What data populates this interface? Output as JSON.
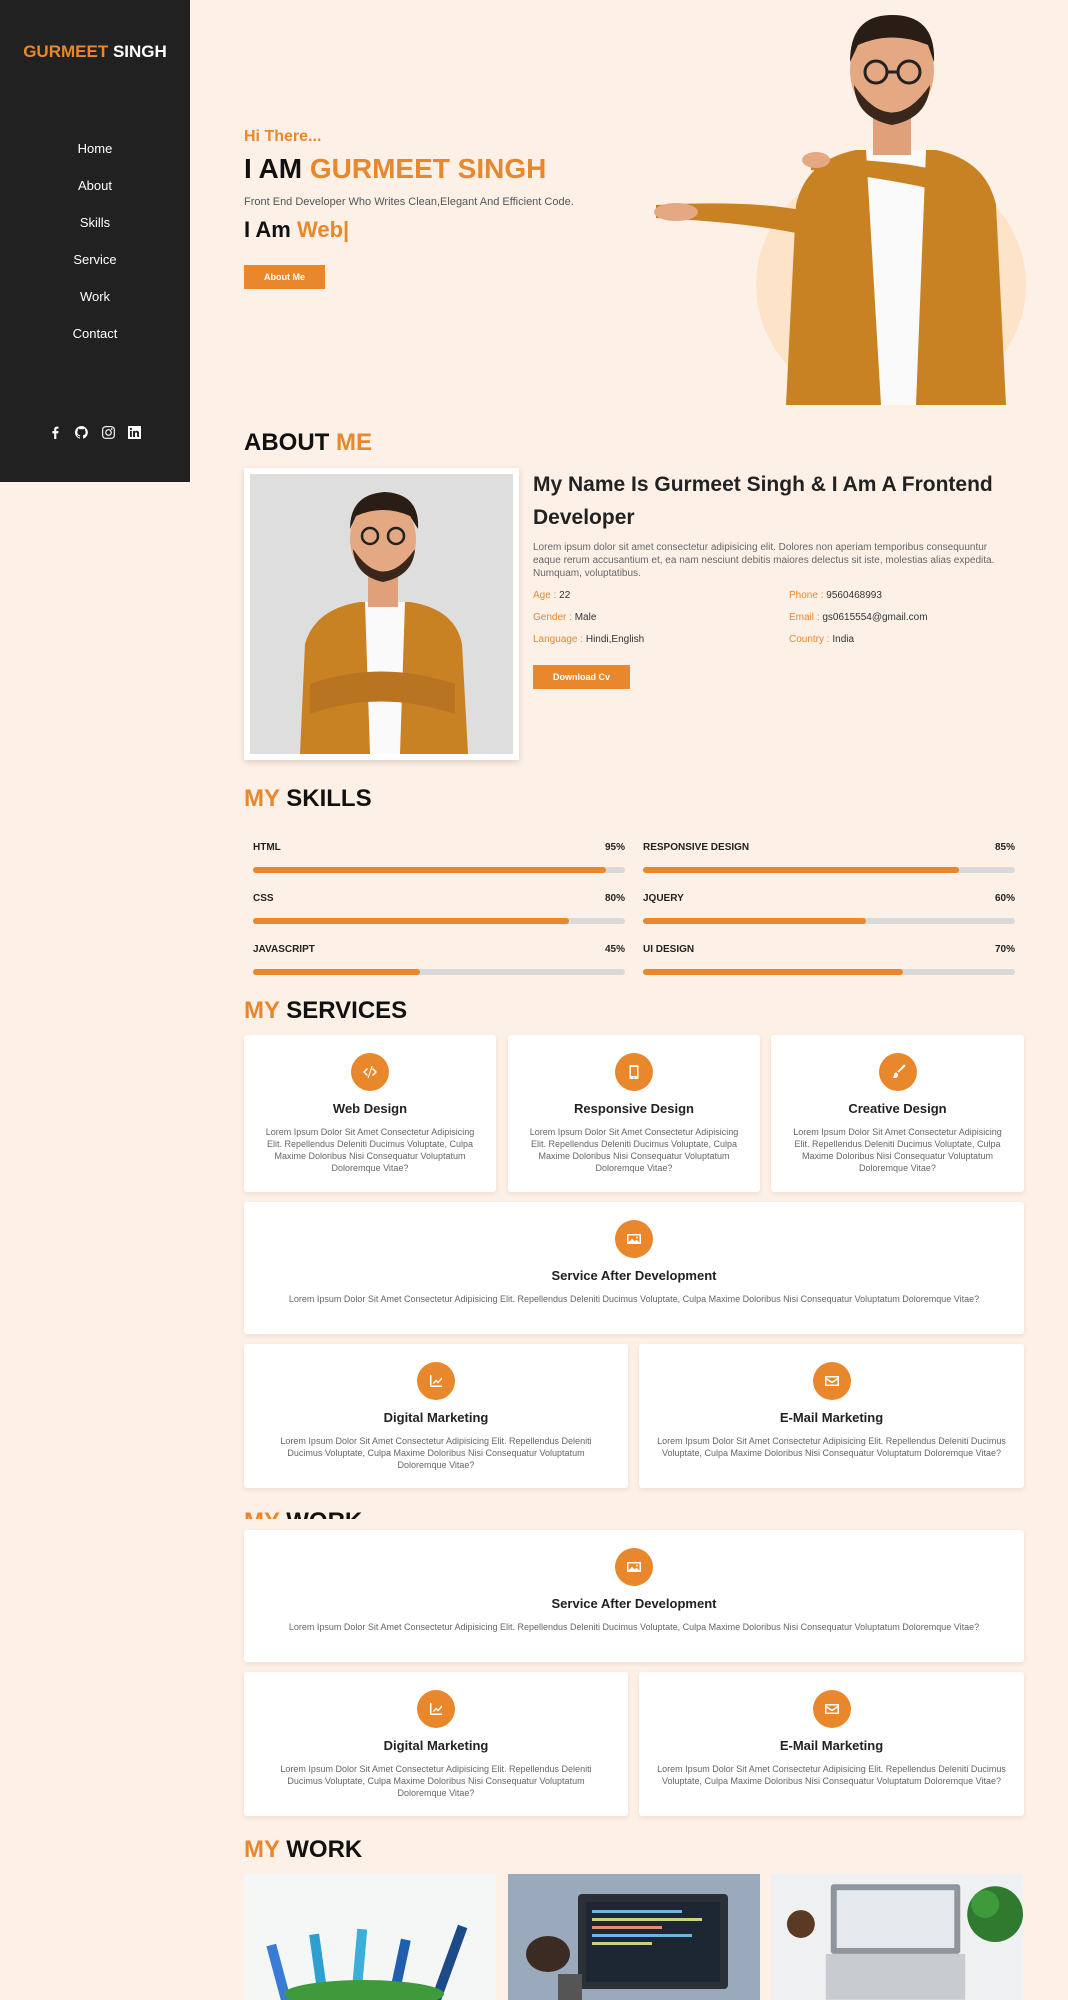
{
  "sidebar": {
    "brand_first": "GURMEET",
    "brand_last": "SINGH",
    "nav": [
      "Home",
      "About",
      "Skills",
      "Service",
      "Work",
      "Contact"
    ],
    "socials": [
      "facebook-icon",
      "github-icon",
      "instagram-icon",
      "linkedin-icon"
    ]
  },
  "hero": {
    "greeting": "Hi There...",
    "title_prefix": "I AM",
    "title_name": "GURMEET SINGH",
    "subtitle": "Front End Developer Who Writes Clean,Elegant And Efficient Code.",
    "typed_prefix": "I Am",
    "typed_word": "Web|",
    "button": "About Me"
  },
  "about": {
    "heading_first": "ABOUT",
    "heading_second": "ME",
    "name_line": "My Name Is Gurmeet Singh & I Am A Frontend Developer",
    "paragraph": "Lorem ipsum dolor sit amet consectetur adipisicing elit. Dolores non aperiam temporibus consequuntur eaque rerum accusantium et, ea nam nesciunt debitis maiores delectus sit iste, molestias alias expedita. Numquam, voluptatibus.",
    "info": [
      {
        "key": "Age :",
        "value": "22"
      },
      {
        "key": "Phone :",
        "value": "9560468993"
      },
      {
        "key": "Gender :",
        "value": "Male"
      },
      {
        "key": "Email :",
        "value": "gs0615554@gmail.com"
      },
      {
        "key": "Language :",
        "value": "Hindi,English"
      },
      {
        "key": "Country :",
        "value": "India"
      }
    ],
    "button": "Download Cv"
  },
  "skills": {
    "heading_first": "MY",
    "heading_second": "SKILLS",
    "items": [
      {
        "name": "HTML",
        "percent_label": "95%",
        "level": 0.95
      },
      {
        "name": "RESPONSIVE DESIGN",
        "percent_label": "85%",
        "level": 0.85
      },
      {
        "name": "CSS",
        "percent_label": "80%",
        "level": 0.85
      },
      {
        "name": "JQUERY",
        "percent_label": "60%",
        "level": 0.6
      },
      {
        "name": "JAVASCRIPT",
        "percent_label": "45%",
        "level": 0.45
      },
      {
        "name": "UI DESIGN",
        "percent_label": "70%",
        "level": 0.7
      }
    ]
  },
  "services": {
    "heading_first": "MY",
    "heading_second": "SERVICES",
    "web_design": {
      "title": "Web Design",
      "text": "Lorem Ipsum Dolor Sit Amet Consectetur Adipisicing Elit. Repellendus Deleniti Ducimus Voluptate, Culpa Maxime Doloribus Nisi Consequatur Voluptatum Doloremque Vitae?"
    },
    "responsive_design": {
      "title": "Responsive Design",
      "text": "Lorem Ipsum Dolor Sit Amet Consectetur Adipisicing Elit. Repellendus Deleniti Ducimus Voluptate, Culpa Maxime Doloribus Nisi Consequatur Voluptatum Doloremque Vitae?"
    },
    "creative_design": {
      "title": "Creative Design",
      "text": "Lorem Ipsum Dolor Sit Amet Consectetur Adipisicing Elit. Repellendus Deleniti Ducimus Voluptate, Culpa Maxime Doloribus Nisi Consequatur Voluptatum Doloremque Vitae?"
    },
    "after_dev": {
      "title": "Service After Development",
      "text": "Lorem Ipsum Dolor Sit Amet Consectetur Adipisicing Elit. Repellendus Deleniti Ducimus Voluptate, Culpa Maxime Doloribus Nisi Consequatur Voluptatum Doloremque Vitae?"
    },
    "digital_marketing": {
      "title": "Digital Marketing",
      "text": "Lorem Ipsum Dolor Sit Amet Consectetur Adipisicing Elit. Repellendus Deleniti Ducimus Voluptate, Culpa Maxime Doloribus Nisi Consequatur Voluptatum Doloremque Vitae?"
    },
    "email_marketing": {
      "title": "E-Mail Marketing",
      "text": "Lorem Ipsum Dolor Sit Amet Consectetur Adipisicing Elit. Repellendus Deleniti Ducimus Voluptate, Culpa Maxime Doloribus Nisi Consequatur Voluptatum Doloremque Vitae?"
    }
  },
  "work": {
    "heading_first": "MY",
    "heading_second": "WORK"
  },
  "colors": {
    "accent": "#e8872b",
    "sidebar": "#212121",
    "background": "#fdf1e7"
  }
}
